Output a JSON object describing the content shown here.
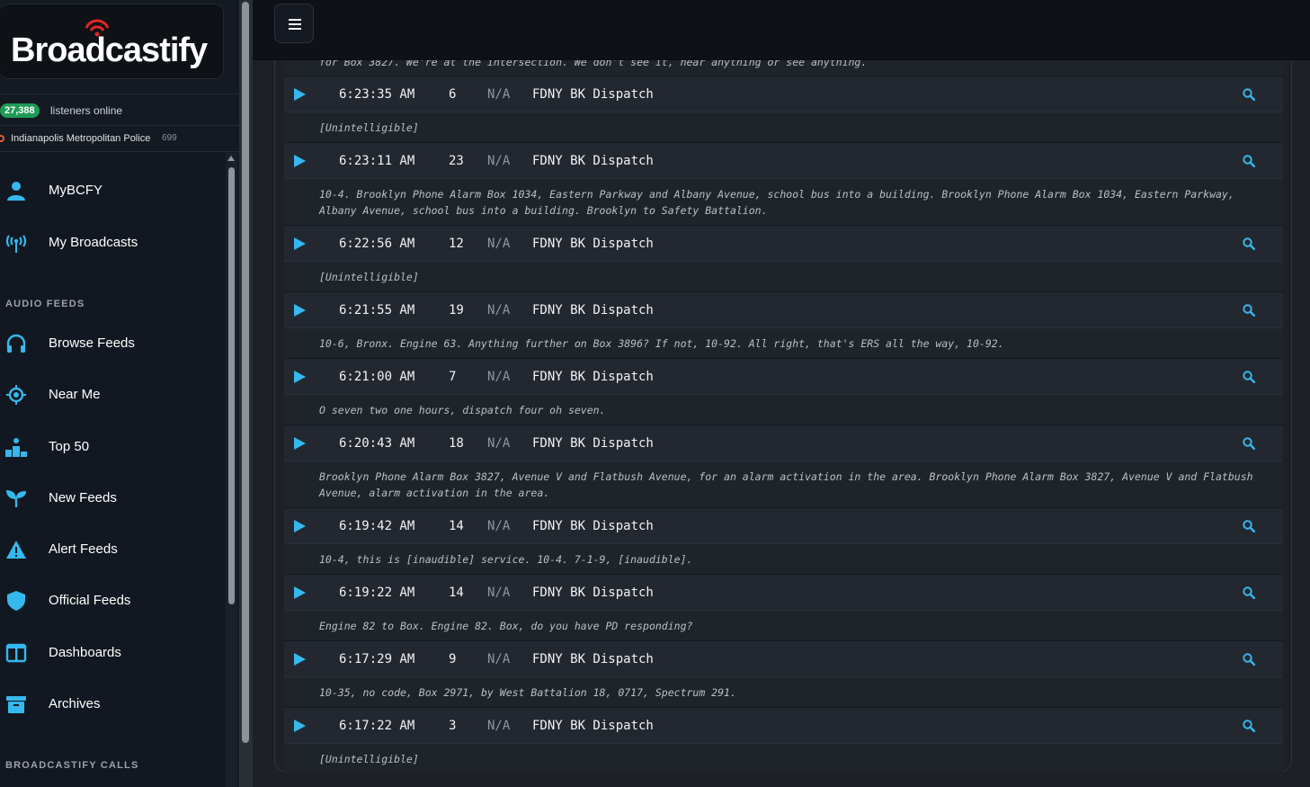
{
  "brand": {
    "name": "Broadcastify",
    "accent": "#e32626"
  },
  "listeners": {
    "count": "27,388",
    "label": "listeners online"
  },
  "trending": {
    "name": "Indianapolis Metropolitan Police",
    "count": "699"
  },
  "nav": {
    "mybcfy": {
      "label": "MyBCFY",
      "icon": "user-icon"
    },
    "my_broadcasts": {
      "label": "My Broadcasts",
      "icon": "broadcast-tower-icon"
    },
    "section_audio": "AUDIO FEEDS",
    "browse": {
      "label": "Browse Feeds",
      "icon": "headphones-icon"
    },
    "near_me": {
      "label": "Near Me",
      "icon": "crosshair-icon"
    },
    "top50": {
      "label": "Top 50",
      "icon": "podium-icon"
    },
    "new_feeds": {
      "label": "New Feeds",
      "icon": "sprout-icon"
    },
    "alert_feeds": {
      "label": "Alert Feeds",
      "icon": "warning-icon"
    },
    "official_feeds": {
      "label": "Official Feeds",
      "icon": "shield-icon"
    },
    "dashboards": {
      "label": "Dashboards",
      "icon": "columns-icon"
    },
    "archives": {
      "label": "Archives",
      "icon": "archive-box-icon"
    },
    "section_calls": "BROADCASTIFY CALLS"
  },
  "partial_transcript": "for Box 3827. We're at the intersection. We don't see it, hear anything or see anything.",
  "calls": [
    {
      "time": "6:23:35 AM",
      "duration": "6",
      "source": "N/A",
      "talkgroup": "FDNY BK Dispatch",
      "transcript": "[Unintelligible]"
    },
    {
      "time": "6:23:11 AM",
      "duration": "23",
      "source": "N/A",
      "talkgroup": "FDNY BK Dispatch",
      "transcript": "10-4. Brooklyn Phone Alarm Box 1034, Eastern Parkway and Albany Avenue, school bus into a building. Brooklyn Phone Alarm Box 1034, Eastern Parkway, Albany Avenue, school bus into a building. Brooklyn to Safety Battalion."
    },
    {
      "time": "6:22:56 AM",
      "duration": "12",
      "source": "N/A",
      "talkgroup": "FDNY BK Dispatch",
      "transcript": "[Unintelligible]"
    },
    {
      "time": "6:21:55 AM",
      "duration": "19",
      "source": "N/A",
      "talkgroup": "FDNY BK Dispatch",
      "transcript": "10-6, Bronx. Engine 63. Anything further on Box 3896? If not, 10-92. All right, that's ERS all the way, 10-92."
    },
    {
      "time": "6:21:00 AM",
      "duration": "7",
      "source": "N/A",
      "talkgroup": "FDNY BK Dispatch",
      "transcript": "O seven two one hours, dispatch four oh seven."
    },
    {
      "time": "6:20:43 AM",
      "duration": "18",
      "source": "N/A",
      "talkgroup": "FDNY BK Dispatch",
      "transcript": "Brooklyn Phone Alarm Box 3827, Avenue V and Flatbush Avenue, for an alarm activation in the area. Brooklyn Phone Alarm Box 3827, Avenue V and Flatbush Avenue, alarm activation in the area."
    },
    {
      "time": "6:19:42 AM",
      "duration": "14",
      "source": "N/A",
      "talkgroup": "FDNY BK Dispatch",
      "transcript": "10-4, this is [inaudible] service. 10-4. 7-1-9, [inaudible]."
    },
    {
      "time": "6:19:22 AM",
      "duration": "14",
      "source": "N/A",
      "talkgroup": "FDNY BK Dispatch",
      "transcript": "Engine 82 to Box. Engine 82. Box, do you have PD responding?"
    },
    {
      "time": "6:17:29 AM",
      "duration": "9",
      "source": "N/A",
      "talkgroup": "FDNY BK Dispatch",
      "transcript": "10-35, no code, Box 2971, by West Battalion 18, 0717, Spectrum 291."
    },
    {
      "time": "6:17:22 AM",
      "duration": "3",
      "source": "N/A",
      "talkgroup": "FDNY BK Dispatch",
      "transcript": "[Unintelligible]"
    }
  ]
}
